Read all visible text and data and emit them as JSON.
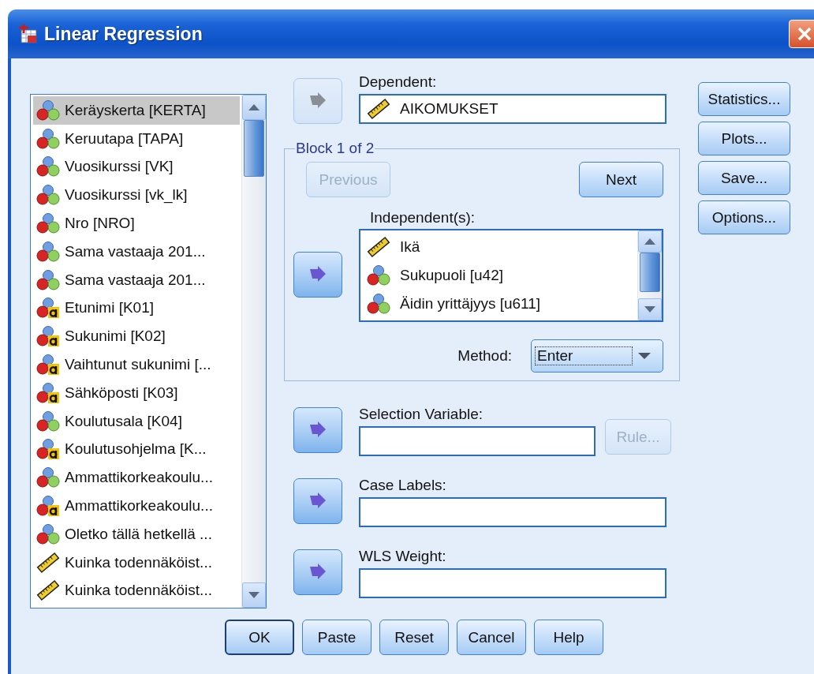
{
  "window": {
    "title": "Linear Regression"
  },
  "variables": [
    {
      "label": "Keräyskerta [KERTA]",
      "kind": "nominal",
      "selected": true
    },
    {
      "label": "Keruutapa [TAPA]",
      "kind": "nominal",
      "selected": false
    },
    {
      "label": "Vuosikurssi [VK]",
      "kind": "nominal",
      "selected": false
    },
    {
      "label": "Vuosikurssi [vk_lk]",
      "kind": "nominal",
      "selected": false
    },
    {
      "label": "Nro [NRO]",
      "kind": "nominal",
      "selected": false
    },
    {
      "label": "Sama vastaaja 201...",
      "kind": "nominal",
      "selected": false
    },
    {
      "label": "Sama vastaaja 201...",
      "kind": "nominal",
      "selected": false
    },
    {
      "label": "Etunimi [K01]",
      "kind": "string",
      "selected": false
    },
    {
      "label": "Sukunimi [K02]",
      "kind": "string",
      "selected": false
    },
    {
      "label": "Vaihtunut sukunimi [...",
      "kind": "string",
      "selected": false
    },
    {
      "label": "Sähköposti [K03]",
      "kind": "string",
      "selected": false
    },
    {
      "label": "Koulutusala [K04]",
      "kind": "nominal",
      "selected": false
    },
    {
      "label": "Koulutusohjelma [K...",
      "kind": "string",
      "selected": false
    },
    {
      "label": "Ammattikorkeakoulu...",
      "kind": "nominal",
      "selected": false
    },
    {
      "label": "Ammattikorkeakoulu...",
      "kind": "string",
      "selected": false
    },
    {
      "label": "Oletko tällä hetkellä ...",
      "kind": "nominal",
      "selected": false
    },
    {
      "label": "Kuinka todennäköist...",
      "kind": "scale",
      "selected": false
    },
    {
      "label": "Kuinka todennäköist...",
      "kind": "scale",
      "selected": false
    }
  ],
  "dependent": {
    "label": "Dependent:",
    "move_disabled": true,
    "items": [
      {
        "label": "AIKOMUKSET",
        "kind": "scale"
      }
    ]
  },
  "block": {
    "title": "Block 1 of 2",
    "buttons": [
      {
        "label": "Previous",
        "disabled": true
      },
      {
        "label": "Next",
        "disabled": false
      }
    ],
    "independents": {
      "label": "Independent(s):",
      "move_disabled": false,
      "items": [
        {
          "label": "Ikä",
          "kind": "scale"
        },
        {
          "label": "Sukupuoli [u42]",
          "kind": "nominal"
        },
        {
          "label": "Äidin yrittäjyys [u611]",
          "kind": "nominal"
        }
      ]
    },
    "method": {
      "label": "Method:",
      "value": "Enter"
    }
  },
  "selection": {
    "label": "Selection Variable:",
    "move_disabled": false,
    "rule": {
      "label": "Rule...",
      "disabled": true
    }
  },
  "case_labels": {
    "label": "Case Labels:",
    "move_disabled": false
  },
  "wls_weight": {
    "label": "WLS Weight:",
    "move_disabled": false
  },
  "side_buttons": [
    "Statistics...",
    "Plots...",
    "Save...",
    "Options..."
  ],
  "footer_buttons": [
    {
      "label": "OK",
      "default": true
    },
    {
      "label": "Paste",
      "default": false
    },
    {
      "label": "Reset",
      "default": false
    },
    {
      "label": "Cancel",
      "default": false
    },
    {
      "label": "Help",
      "default": false
    }
  ]
}
